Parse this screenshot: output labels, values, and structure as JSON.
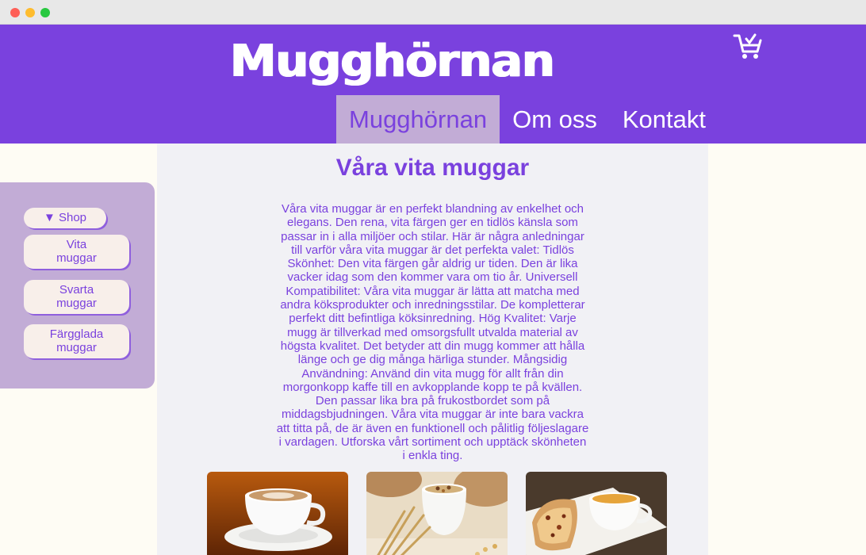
{
  "brand": {
    "logo": "Mugghörnan",
    "accent_color": "#7a41de",
    "nav_active_bg": "#c2acd6"
  },
  "header": {
    "cart_icon": "shopping-cart-icon"
  },
  "nav": {
    "items": [
      {
        "label": "Mugghörnan",
        "active": true
      },
      {
        "label": "Om oss",
        "active": false
      },
      {
        "label": "Kontakt",
        "active": false
      }
    ]
  },
  "sidebar": {
    "toggle_icon": "▼",
    "toggle_label": "Shop",
    "links": [
      {
        "line1": "Vita",
        "line2": "muggar"
      },
      {
        "line1": "Svarta",
        "line2": "muggar"
      },
      {
        "line1": "Färgglada",
        "line2": "muggar"
      }
    ]
  },
  "main": {
    "title": "Våra vita muggar",
    "intro": "Våra vita muggar är en perfekt blandning av enkelhet och elegans. Den rena, vita färgen ger en tidlös känsla som passar in i alla miljöer och stilar. Här är några anledningar till varför våra vita muggar är det perfekta valet: Tidlös Skönhet: Den vita färgen går aldrig ur tiden. Den är lika vacker idag som den kommer vara om tio år. Universell Kompatibilitet: Våra vita muggar är lätta att matcha med andra köksprodukter och inredningsstilar. De kompletterar perfekt ditt befintliga köksinredning. Hög Kvalitet: Varje mugg är tillverkad med omsorgsfullt utvalda material av högsta kvalitet. Det betyder att din mugg kommer att hålla länge och ge dig många härliga stunder. Mångsidig Användning: Använd din vita mugg för allt från din morgonkopp kaffe till en avkopplande kopp te på kvällen. Den passar lika bra på frukostbordet som på middagsbjudningen. Våra vita muggar är inte bara vackra att titta på, de är även en funktionell och pålitlig följeslagare i vardagen. Utforska vårt sortiment och upptäck skönheten i enkla ting."
  },
  "gallery": {
    "images": [
      "white-cappuccino-cup-image",
      "white-cereal-mug-with-wheat-image",
      "white-tea-cup-with-cake-image"
    ]
  }
}
